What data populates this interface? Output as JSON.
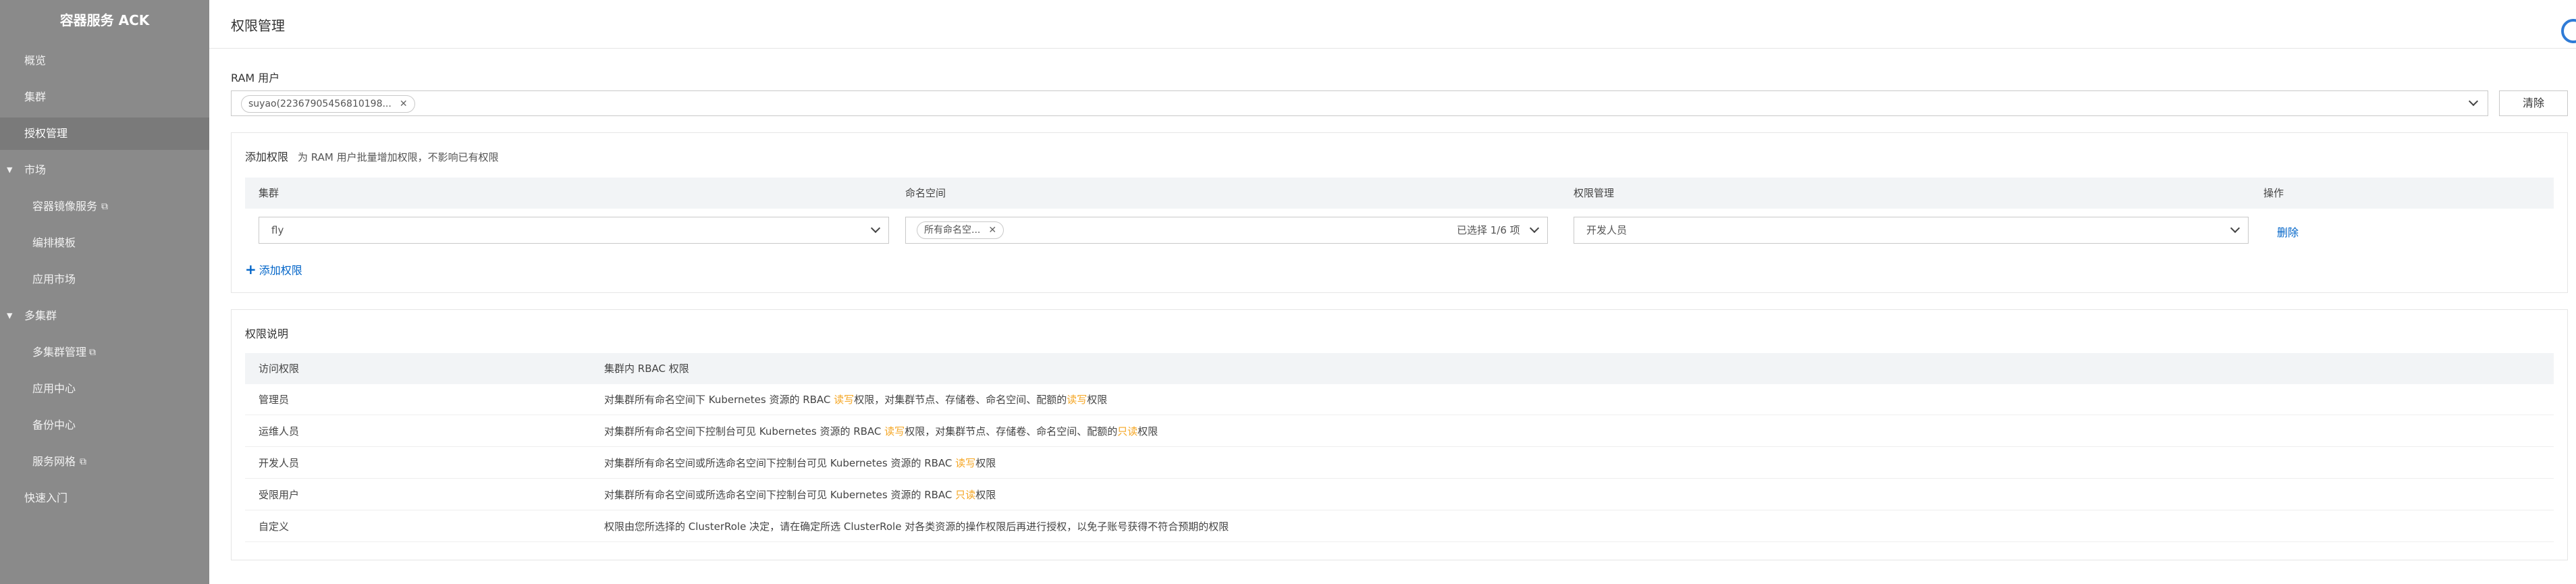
{
  "sidebar": {
    "title": "容器服务 ACK",
    "items": [
      {
        "label": "概览"
      },
      {
        "label": "集群"
      },
      {
        "label": "授权管理"
      }
    ],
    "market": {
      "label": "市场",
      "items": [
        {
          "label": "容器镜像服务",
          "external": true
        },
        {
          "label": "编排模板"
        },
        {
          "label": "应用市场"
        }
      ]
    },
    "multi": {
      "label": "多集群",
      "items": [
        {
          "label": "多集群管理",
          "external": true
        },
        {
          "label": "应用中心"
        },
        {
          "label": "备份中心"
        },
        {
          "label": "服务网格",
          "external": true
        }
      ]
    },
    "quickstart": {
      "label": "快速入门"
    }
  },
  "header": {
    "title": "权限管理"
  },
  "ram": {
    "label": "RAM 用户",
    "selected_tag": "suyao(2236790545681019​8...",
    "clear_label": "清除"
  },
  "add_panel": {
    "title": "添加权限",
    "subtitle": "为 RAM 用户批量增加权限，不影响已有权限",
    "columns": {
      "cluster": "集群",
      "namespace": "命名空间",
      "permission": "权限管理",
      "action": "操作"
    },
    "row": {
      "cluster": "fly",
      "namespace_tag": "所有命名空...",
      "namespace_count": "已选择 1/6 项",
      "permission": "开发人员",
      "delete_label": "删除"
    },
    "add_label": "添加权限"
  },
  "desc_panel": {
    "title": "权限说明",
    "columns": {
      "access": "访问权限",
      "rbac": "集群内 RBAC 权限"
    },
    "rows": [
      {
        "role": "管理员",
        "parts": [
          "对集群所有命名空间下 Kubernetes 资源的 RBAC ",
          "读写",
          "权限，对集群节点、存储卷、命名空间、配额的",
          "读写",
          "权限"
        ]
      },
      {
        "role": "运维人员",
        "parts": [
          "对集群所有命名空间下控制台可见 Kubernetes 资源的 RBAC ",
          "读写",
          "权限，对集群节点、存储卷、命名空间、配额的",
          "只读",
          "权限"
        ]
      },
      {
        "role": "开发人员",
        "parts": [
          "对集群所有命名空间或所选命名空间下控制台可见 Kubernetes 资源的 RBAC ",
          "读写",
          "权限"
        ]
      },
      {
        "role": "受限用户",
        "parts": [
          "对集群所有命名空间或所选命名空间下控制台可见 Kubernetes 资源的 RBAC ",
          "只读",
          "权限"
        ]
      },
      {
        "role": "自定义",
        "parts": [
          "权限由您所选择的 ClusterRole 决定，请在确定所选 ClusterRole 对各类资源的操作权限后再进行授权，以免子账号获得不符合预期的权限"
        ]
      }
    ]
  },
  "colors": {
    "sidebar_bg": "#8a8a8a",
    "link": "#0064c8",
    "highlight": "#f5a623",
    "table_header": "#f2f4f6"
  }
}
